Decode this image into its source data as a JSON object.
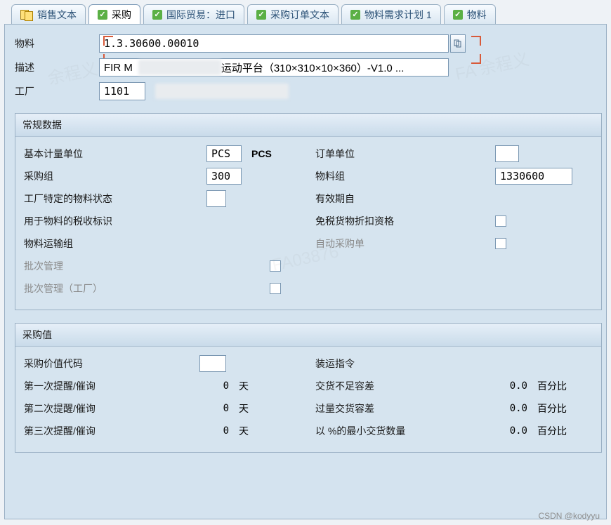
{
  "tabs": [
    {
      "label": "销售文本"
    },
    {
      "label": "采购",
      "active": true
    },
    {
      "label": "国际贸易：进口"
    },
    {
      "label": "采购订单文本"
    },
    {
      "label": "物料需求计划 1"
    },
    {
      "label": "物料"
    }
  ],
  "header": {
    "material_label": "物料",
    "material_value": "1.3.30600.00010",
    "desc_label": "描述",
    "desc_value_pre": "FIR M",
    "desc_value_post": "运动平台（310×310×10×360）-V1.0 ...",
    "plant_label": "工厂",
    "plant_value": "1101"
  },
  "panel1": {
    "title": "常规数据",
    "left": {
      "l1": "基本计量单位",
      "v1": "PCS",
      "v1b": "PCS",
      "l2": "采购组",
      "v2": "300",
      "l3": "工厂特定的物料状态",
      "l4": "用于物料的税收标识",
      "l5": "物料运输组",
      "l6": "批次管理",
      "l7": "批次管理（工厂）"
    },
    "right": {
      "l1": "订单单位",
      "l2": "物料组",
      "v2": "1330600",
      "l3": "有效期自",
      "l4": "免税货物折扣资格",
      "l5": "自动采购单"
    }
  },
  "panel2": {
    "title": "采购值",
    "left": {
      "l1": "采购价值代码",
      "l2": "第一次提醒/催询",
      "v2": "0",
      "u2": "天",
      "l3": "第二次提醒/催询",
      "v3": "0",
      "u3": "天",
      "l4": "第三次提醒/催询",
      "v4": "0",
      "u4": "天"
    },
    "right": {
      "l1": "装运指令",
      "l2": "交货不足容差",
      "v2": "0.0",
      "u2": "百分比",
      "l3": "过量交货容差",
      "v3": "0.0",
      "u3": "百分比",
      "l4": "以 %的最小交货数量",
      "v4": "0.0",
      "u4": "百分比"
    }
  },
  "credit": "CSDN @kodyyu"
}
